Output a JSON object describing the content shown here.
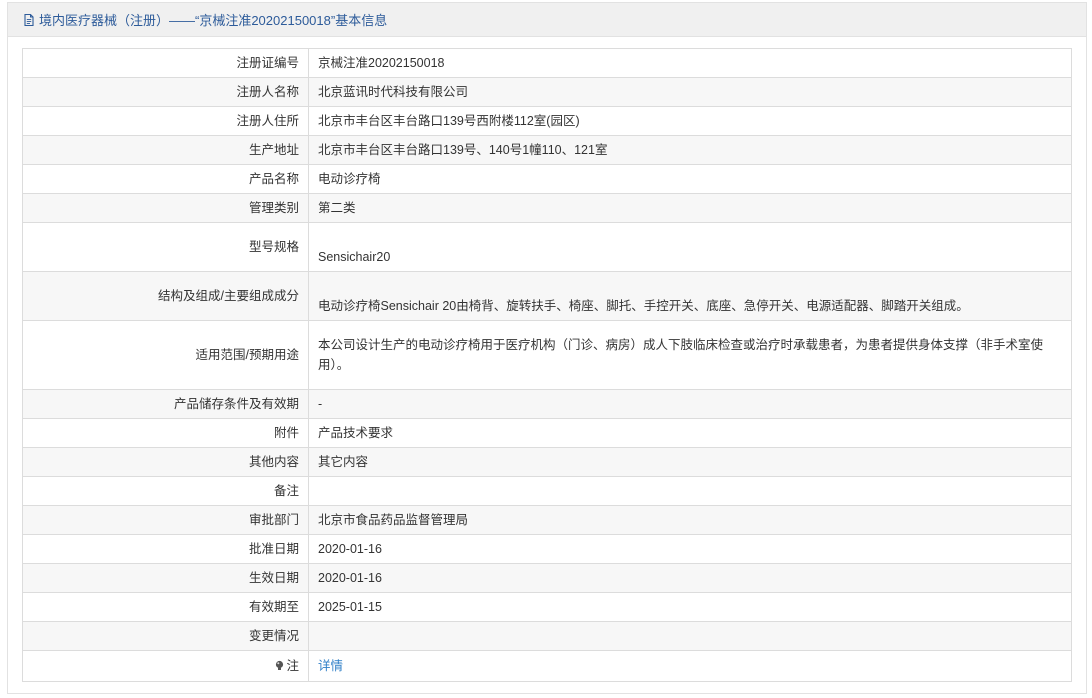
{
  "header": {
    "title": "境内医疗器械（注册）——“京械注准20202150018”基本信息",
    "icon": "document-icon"
  },
  "rows": [
    {
      "label": "注册证编号",
      "value": "京械注准20202150018"
    },
    {
      "label": "注册人名称",
      "value": "北京蓝讯时代科技有限公司"
    },
    {
      "label": "注册人住所",
      "value": "北京市丰台区丰台路口139号西附楼112室(园区)"
    },
    {
      "label": "生产地址",
      "value": "北京市丰台区丰台路口139号、140号1幢110、121室"
    },
    {
      "label": "产品名称",
      "value": "电动诊疗椅"
    },
    {
      "label": "管理类别",
      "value": "第二类"
    },
    {
      "label": "型号规格",
      "value": "Sensichair20"
    },
    {
      "label": "结构及组成/主要组成成分",
      "value": "电动诊疗椅Sensichair 20由椅背、旋转扶手、椅座、脚托、手控开关、底座、急停开关、电源适配器、脚踏开关组成。"
    },
    {
      "label": "适用范围/预期用途",
      "value": "本公司设计生产的电动诊疗椅用于医疗机构（门诊、病房）成人下肢临床检查或治疗时承载患者，为患者提供身体支撑（非手术室使用）。"
    },
    {
      "label": "产品储存条件及有效期",
      "value": "-"
    },
    {
      "label": "附件",
      "value": "产品技术要求"
    },
    {
      "label": "其他内容",
      "value": "其它内容"
    },
    {
      "label": "备注",
      "value": ""
    },
    {
      "label": "审批部门",
      "value": "北京市食品药品监督管理局"
    },
    {
      "label": "批准日期",
      "value": "2020-01-16"
    },
    {
      "label": "生效日期",
      "value": "2020-01-16"
    },
    {
      "label": "有效期至",
      "value": "2025-01-15"
    },
    {
      "label": "变更情况",
      "value": ""
    },
    {
      "label": "注",
      "value": "详情",
      "icon": "bulb-icon"
    }
  ],
  "colors": {
    "header_text": "#2d5b9a",
    "link": "#2f7fc7",
    "border": "#dcdcdc",
    "alt_row": "#f7f7f7"
  }
}
